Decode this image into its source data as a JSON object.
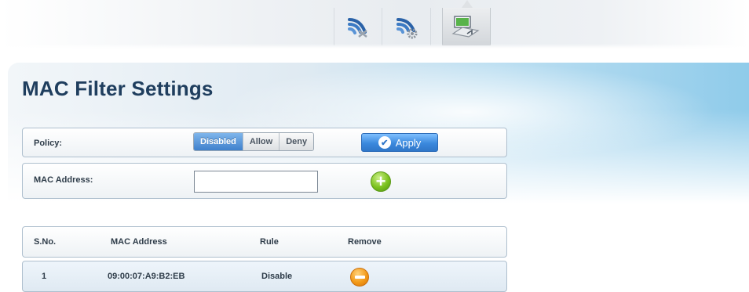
{
  "nav": {
    "icons": [
      {
        "name": "wireless-icon",
        "active": false
      },
      {
        "name": "wireless-settings-icon",
        "active": false
      },
      {
        "name": "mac-filter-icon",
        "active": true
      }
    ]
  },
  "page": {
    "title": "MAC Filter Settings"
  },
  "policy": {
    "label": "Policy:",
    "options": [
      "Disabled",
      "Allow",
      "Deny"
    ],
    "selected": "Disabled",
    "apply_label": "Apply"
  },
  "mac_entry": {
    "label": "MAC Address:",
    "value": "",
    "placeholder": ""
  },
  "table": {
    "headers": {
      "sno": "S.No.",
      "mac": "MAC Address",
      "rule": "Rule",
      "remove": "Remove"
    },
    "rows": [
      {
        "sno": "1",
        "mac": "09:00:07:A9:B2:EB",
        "rule": "Disable"
      }
    ]
  },
  "colors": {
    "accent_blue": "#3f80cc",
    "title": "#1f3e5e",
    "add_green": "#7cc21f",
    "remove_orange": "#f39a18"
  }
}
